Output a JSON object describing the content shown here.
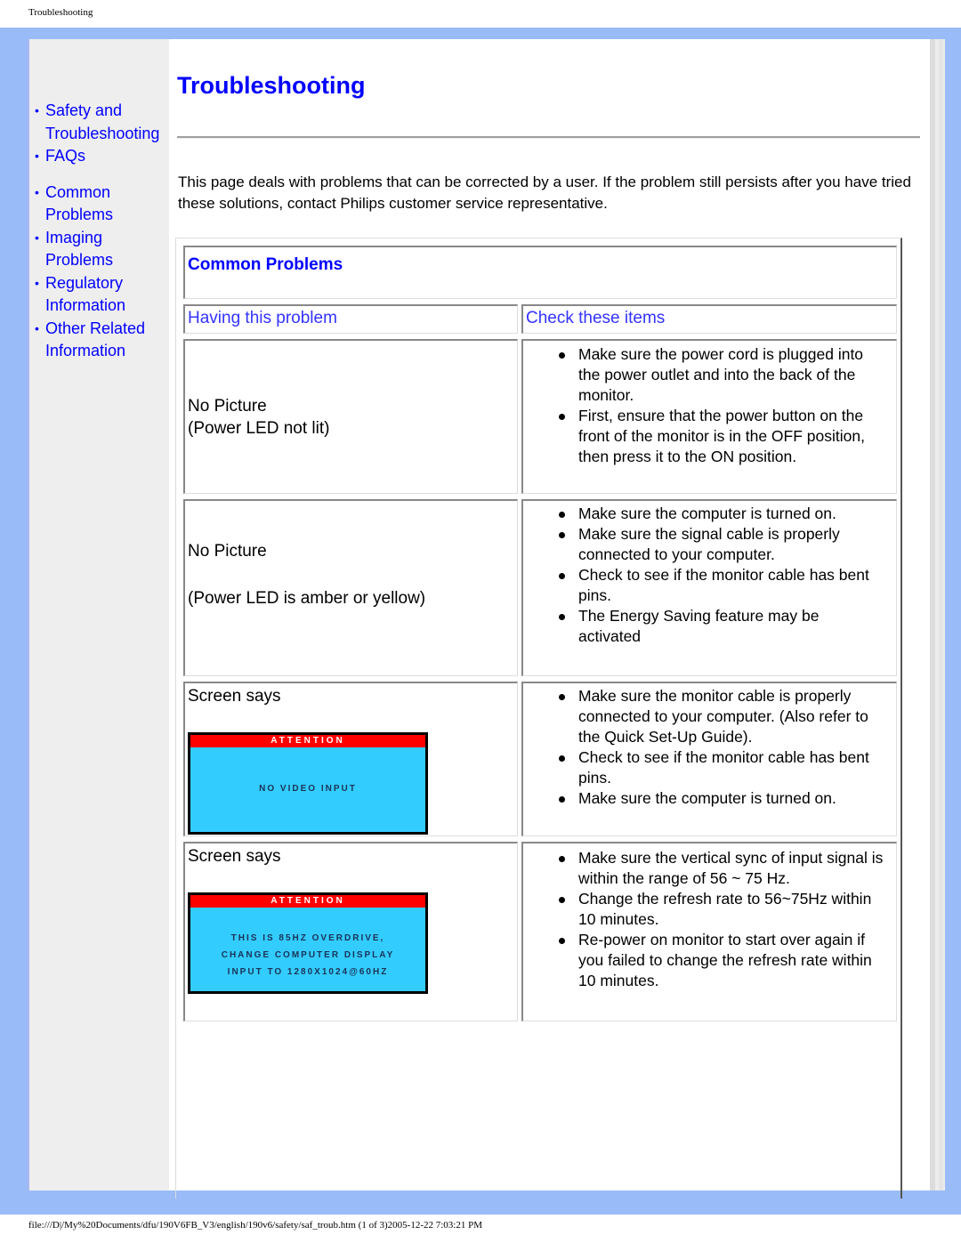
{
  "print_header": "Troubleshooting",
  "print_footer": "file:///D|/My%20Documents/dfu/190V6FB_V3/english/190v6/safety/saf_troub.htm (1 of 3)2005-12-22 7:03:21 PM",
  "colors": {
    "frame": "#99bbf7",
    "sidebar": "#eeeeee",
    "link": "#0000ff",
    "header_link": "#3333ff",
    "osd_bar": "#ff0000",
    "osd_body": "#33ccff"
  },
  "sidebar": {
    "items": [
      {
        "label": "Safety and Troubleshooting",
        "icon": "bullet"
      },
      {
        "label": "FAQs",
        "icon": "bullet"
      },
      {
        "label": "Common Problems",
        "icon": "bullet"
      },
      {
        "label": "Imaging Problems",
        "icon": "bullet"
      },
      {
        "label": "Regulatory Information",
        "icon": "bullet"
      },
      {
        "label": "Other Related Information",
        "icon": "bullet"
      }
    ]
  },
  "main": {
    "title": "Troubleshooting",
    "intro": "This page deals with problems that can be corrected by a user. If the problem still persists after you have tried these solutions, contact Philips customer service representative.",
    "section_title": "Common Problems",
    "table": {
      "headers": [
        "Having this problem",
        "Check these items"
      ],
      "rows": [
        {
          "problem": [
            "No Picture",
            "(Power LED not lit)"
          ],
          "checks": [
            "Make sure the power cord is plugged into the power outlet and into the back of the monitor.",
            "First, ensure that the power button on the front of the monitor is in the OFF position, then press it to the ON position."
          ]
        },
        {
          "problem": [
            "No Picture",
            "(Power LED is amber or yellow)"
          ],
          "checks": [
            "Make sure the computer is turned on.",
            "Make sure the signal cable is properly connected to your computer.",
            "Check to see if the monitor cable has bent pins.",
            "The Energy Saving feature may be activated"
          ]
        },
        {
          "problem": [
            "Screen says"
          ],
          "osd": {
            "bar": "ATTENTION",
            "lines": [
              "NO VIDEO INPUT"
            ]
          },
          "checks": [
            "Make sure the monitor cable is properly connected to your computer. (Also refer to the Quick Set-Up Guide).",
            "Check to see if the monitor cable has bent pins.",
            "Make sure the computer is turned on."
          ]
        },
        {
          "problem": [
            "Screen says"
          ],
          "osd": {
            "bar": "ATTENTION",
            "lines": [
              "THIS IS 85HZ OVERDRIVE,",
              "CHANGE COMPUTER DISPLAY",
              "INPUT TO 1280X1024@60HZ"
            ]
          },
          "checks": [
            "Make sure the vertical sync of input signal is within the range of 56 ~ 75 Hz.",
            "Change the refresh rate to 56~75Hz within 10 minutes.",
            "Re-power on monitor to start over again if you failed to change the refresh rate within 10 minutes."
          ]
        }
      ]
    }
  }
}
